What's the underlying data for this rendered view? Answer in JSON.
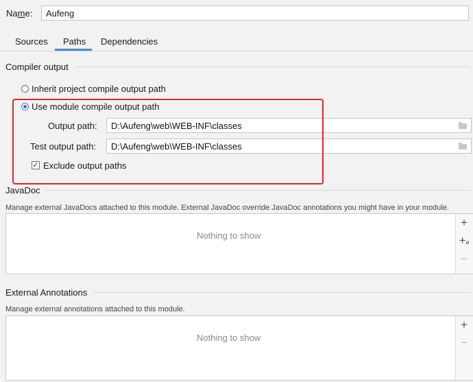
{
  "name": {
    "label_prefix": "Na",
    "label_underlined": "m",
    "label_suffix": "e:",
    "value": "Aufeng"
  },
  "tabs": [
    {
      "label": "Sources"
    },
    {
      "label": "Paths"
    },
    {
      "label": "Dependencies"
    }
  ],
  "active_tab": "Paths",
  "compiler_output": {
    "title": "Compiler output",
    "inherit_label": "Inherit project compile output path",
    "use_module_label": "Use module compile output path",
    "selected": "use_module",
    "output_path_label": "Output path:",
    "output_path_value": "D:\\Aufeng\\web\\WEB-INF\\classes",
    "test_output_path_label": "Test output path:",
    "test_output_path_value": "D:\\Aufeng\\web\\WEB-INF\\classes",
    "exclude_label": "Exclude output paths",
    "exclude_checked": true,
    "check_glyph": "✓"
  },
  "javadoc": {
    "title": "JavaDoc",
    "description": "Manage external JavaDocs attached to this module. External JavaDoc override JavaDoc annotations you might have in your module.",
    "empty_text": "Nothing to show",
    "add_glyph": "+",
    "add_url_glyph": "+",
    "add_url_suffix": "ø",
    "remove_glyph": "−"
  },
  "external_annotations": {
    "title": "External Annotations",
    "description": "Manage external annotations attached to this module.",
    "empty_text": "Nothing to show",
    "add_glyph": "+",
    "remove_glyph": "−"
  },
  "colors": {
    "highlight_border": "#e0262e",
    "accent": "#4a88c7"
  }
}
